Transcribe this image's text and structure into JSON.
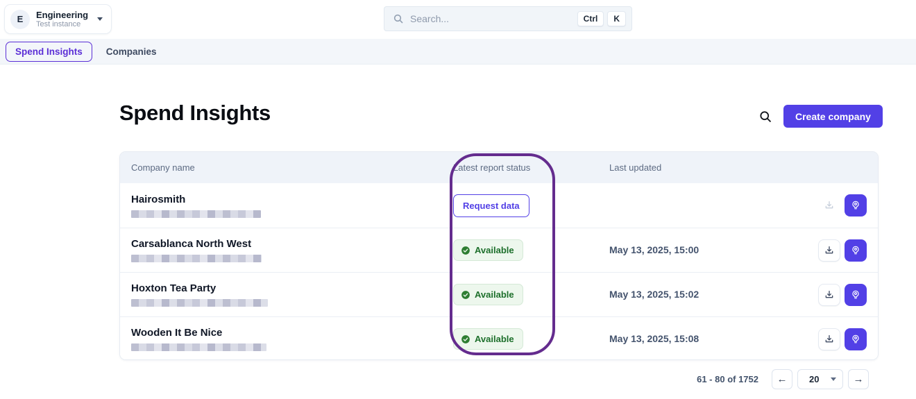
{
  "workspace": {
    "initial": "E",
    "name": "Engineering",
    "subtitle": "Test instance"
  },
  "search": {
    "placeholder": "Search...",
    "shortcut_keys": [
      "Ctrl",
      "K"
    ]
  },
  "nav": {
    "tabs": [
      {
        "label": "Spend Insights"
      },
      {
        "label": "Companies"
      }
    ]
  },
  "page": {
    "title": "Spend Insights",
    "create_button_label": "Create company"
  },
  "table": {
    "columns": [
      "Company name",
      "Latest report status",
      "Last updated"
    ],
    "rows": [
      {
        "name": "Hairosmith",
        "status": "Request data",
        "status_type": "request",
        "last_updated": ""
      },
      {
        "name": "Carsablanca North West",
        "status": "Available",
        "status_type": "available",
        "last_updated": "May 13, 2025, 15:00"
      },
      {
        "name": "Hoxton Tea Party",
        "status": "Available",
        "status_type": "available",
        "last_updated": "May 13, 2025, 15:02"
      },
      {
        "name": "Wooden It Be Nice",
        "status": "Available",
        "status_type": "available",
        "last_updated": "May 13, 2025, 15:08"
      }
    ]
  },
  "annotation": {
    "target": "Latest report status column",
    "color": "#642c8e"
  },
  "pagination": {
    "range_text": "61 - 80 of 1752",
    "page_size": "20",
    "prev_icon": "←",
    "next_icon": "→"
  },
  "colors": {
    "primary": "#5240e6",
    "available_text": "#1d6f2b",
    "available_bg": "#edf7ed",
    "annotation": "#642c8e"
  }
}
